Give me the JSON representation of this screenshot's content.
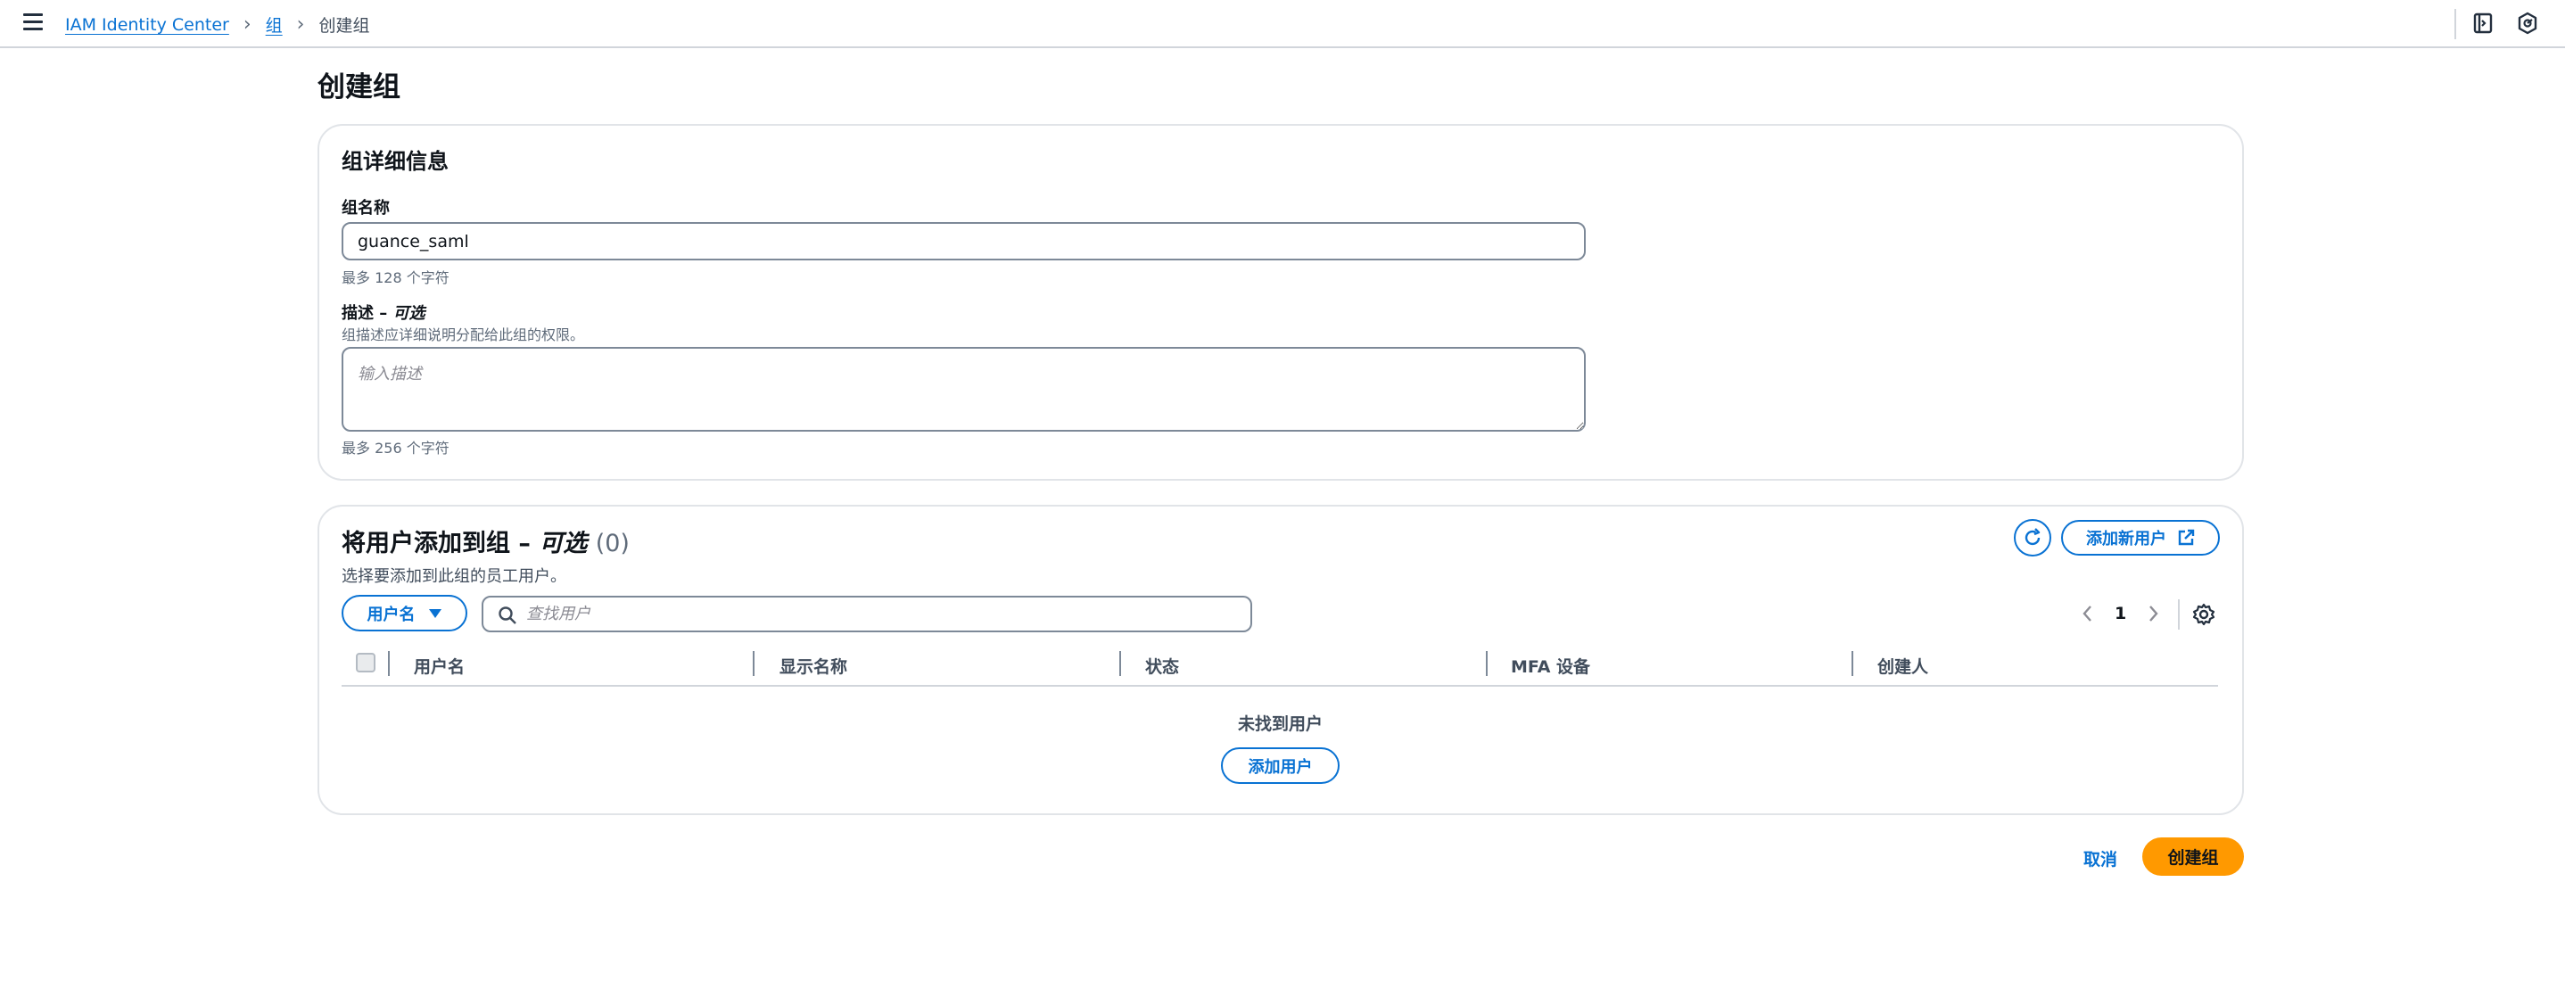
{
  "breadcrumb": {
    "items": [
      "IAM Identity Center",
      "组"
    ],
    "current": "创建组"
  },
  "topbar": {
    "icons": [
      "notes-icon",
      "settings-shield-icon"
    ]
  },
  "page": {
    "title": "创建组"
  },
  "details": {
    "heading": "组详细信息",
    "name_label": "组名称",
    "name_value": "guance_saml",
    "name_hint": "最多 128 个字符",
    "desc_label": "描述 –",
    "desc_label_optional": "可选",
    "desc_help": "组描述应详细说明分配给此组的权限。",
    "desc_placeholder": "输入描述",
    "desc_hint": "最多 256 个字符"
  },
  "users": {
    "heading": "将用户添加到组 –",
    "heading_optional": "可选",
    "count": "(0)",
    "description": "选择要添加到此组的员工用户。",
    "add_new_user_label": "添加新用户",
    "filter_dropdown_label": "用户名",
    "search_placeholder": "查找用户",
    "page_number": "1",
    "columns": [
      "用户名",
      "显示名称",
      "状态",
      "MFA 设备",
      "创建人"
    ],
    "empty_text": "未找到用户",
    "add_user_label": "添加用户"
  },
  "footer": {
    "cancel_label": "取消",
    "create_label": "创建组"
  },
  "colors": {
    "link": "#0972d3",
    "primary": "#ff9900",
    "border": "#7d8998"
  }
}
